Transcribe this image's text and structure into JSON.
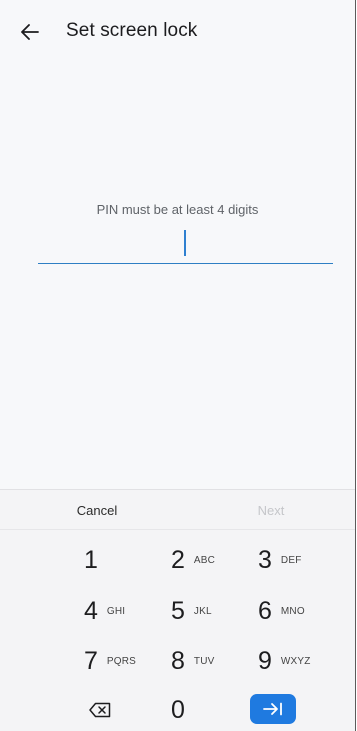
{
  "header": {
    "back_icon": "arrow-left-icon",
    "title": "Set screen lock"
  },
  "pin_entry": {
    "hint": "PIN must be at least 4 digits",
    "value": ""
  },
  "keyboard": {
    "cancel_label": "Cancel",
    "next_label": "Next",
    "next_enabled": false,
    "keys": [
      {
        "digit": "1",
        "letters": ""
      },
      {
        "digit": "2",
        "letters": "ABC"
      },
      {
        "digit": "3",
        "letters": "DEF"
      },
      {
        "digit": "4",
        "letters": "GHI"
      },
      {
        "digit": "5",
        "letters": "JKL"
      },
      {
        "digit": "6",
        "letters": "MNO"
      },
      {
        "digit": "7",
        "letters": "PQRS"
      },
      {
        "digit": "8",
        "letters": "TUV"
      },
      {
        "digit": "9",
        "letters": "WXYZ"
      },
      {
        "digit": "0",
        "letters": ""
      }
    ],
    "backspace_icon": "backspace-icon",
    "enter_icon": "tab-arrow-icon",
    "accent_color": "#1f7ae0"
  }
}
